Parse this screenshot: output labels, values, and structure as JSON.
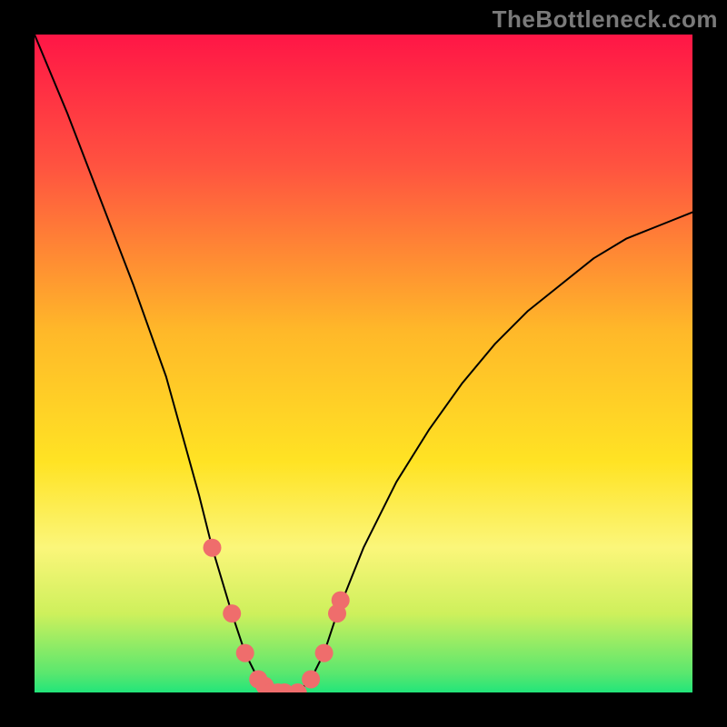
{
  "watermark": "TheBottleneck.com",
  "chart_data": {
    "type": "line",
    "title": "",
    "xlabel": "",
    "ylabel": "",
    "xlim": [
      0,
      100
    ],
    "ylim": [
      0,
      100
    ],
    "grid": false,
    "background_gradient": {
      "top": "#ff1646",
      "bottom": "#22e57a",
      "stops": [
        {
          "offset": 0.0,
          "color": "#ff1646"
        },
        {
          "offset": 0.2,
          "color": "#ff5340"
        },
        {
          "offset": 0.45,
          "color": "#ffb829"
        },
        {
          "offset": 0.65,
          "color": "#ffe324"
        },
        {
          "offset": 0.78,
          "color": "#fbf67a"
        },
        {
          "offset": 0.88,
          "color": "#cef05c"
        },
        {
          "offset": 0.97,
          "color": "#5be76e"
        },
        {
          "offset": 1.0,
          "color": "#22e57a"
        }
      ]
    },
    "series": [
      {
        "name": "bottleneck-curve",
        "x": [
          0,
          5,
          10,
          15,
          20,
          25,
          27,
          30,
          32,
          34,
          36,
          38,
          40,
          42,
          44,
          46,
          50,
          55,
          60,
          65,
          70,
          75,
          80,
          85,
          90,
          95,
          100
        ],
        "values": [
          100,
          88,
          75,
          62,
          48,
          30,
          22,
          12,
          6,
          2,
          0,
          0,
          0,
          2,
          6,
          12,
          22,
          32,
          40,
          47,
          53,
          58,
          62,
          66,
          69,
          71,
          73
        ]
      }
    ],
    "marker_points": {
      "name": "highlight-markers",
      "color": "#ef6d6c",
      "radius_px": 10,
      "x": [
        27,
        30,
        32,
        34,
        35,
        36,
        37,
        38,
        40,
        42,
        44,
        46,
        46.5
      ],
      "values": [
        22,
        12,
        6,
        2,
        1,
        0,
        0,
        0,
        0,
        2,
        6,
        12,
        14
      ]
    }
  }
}
